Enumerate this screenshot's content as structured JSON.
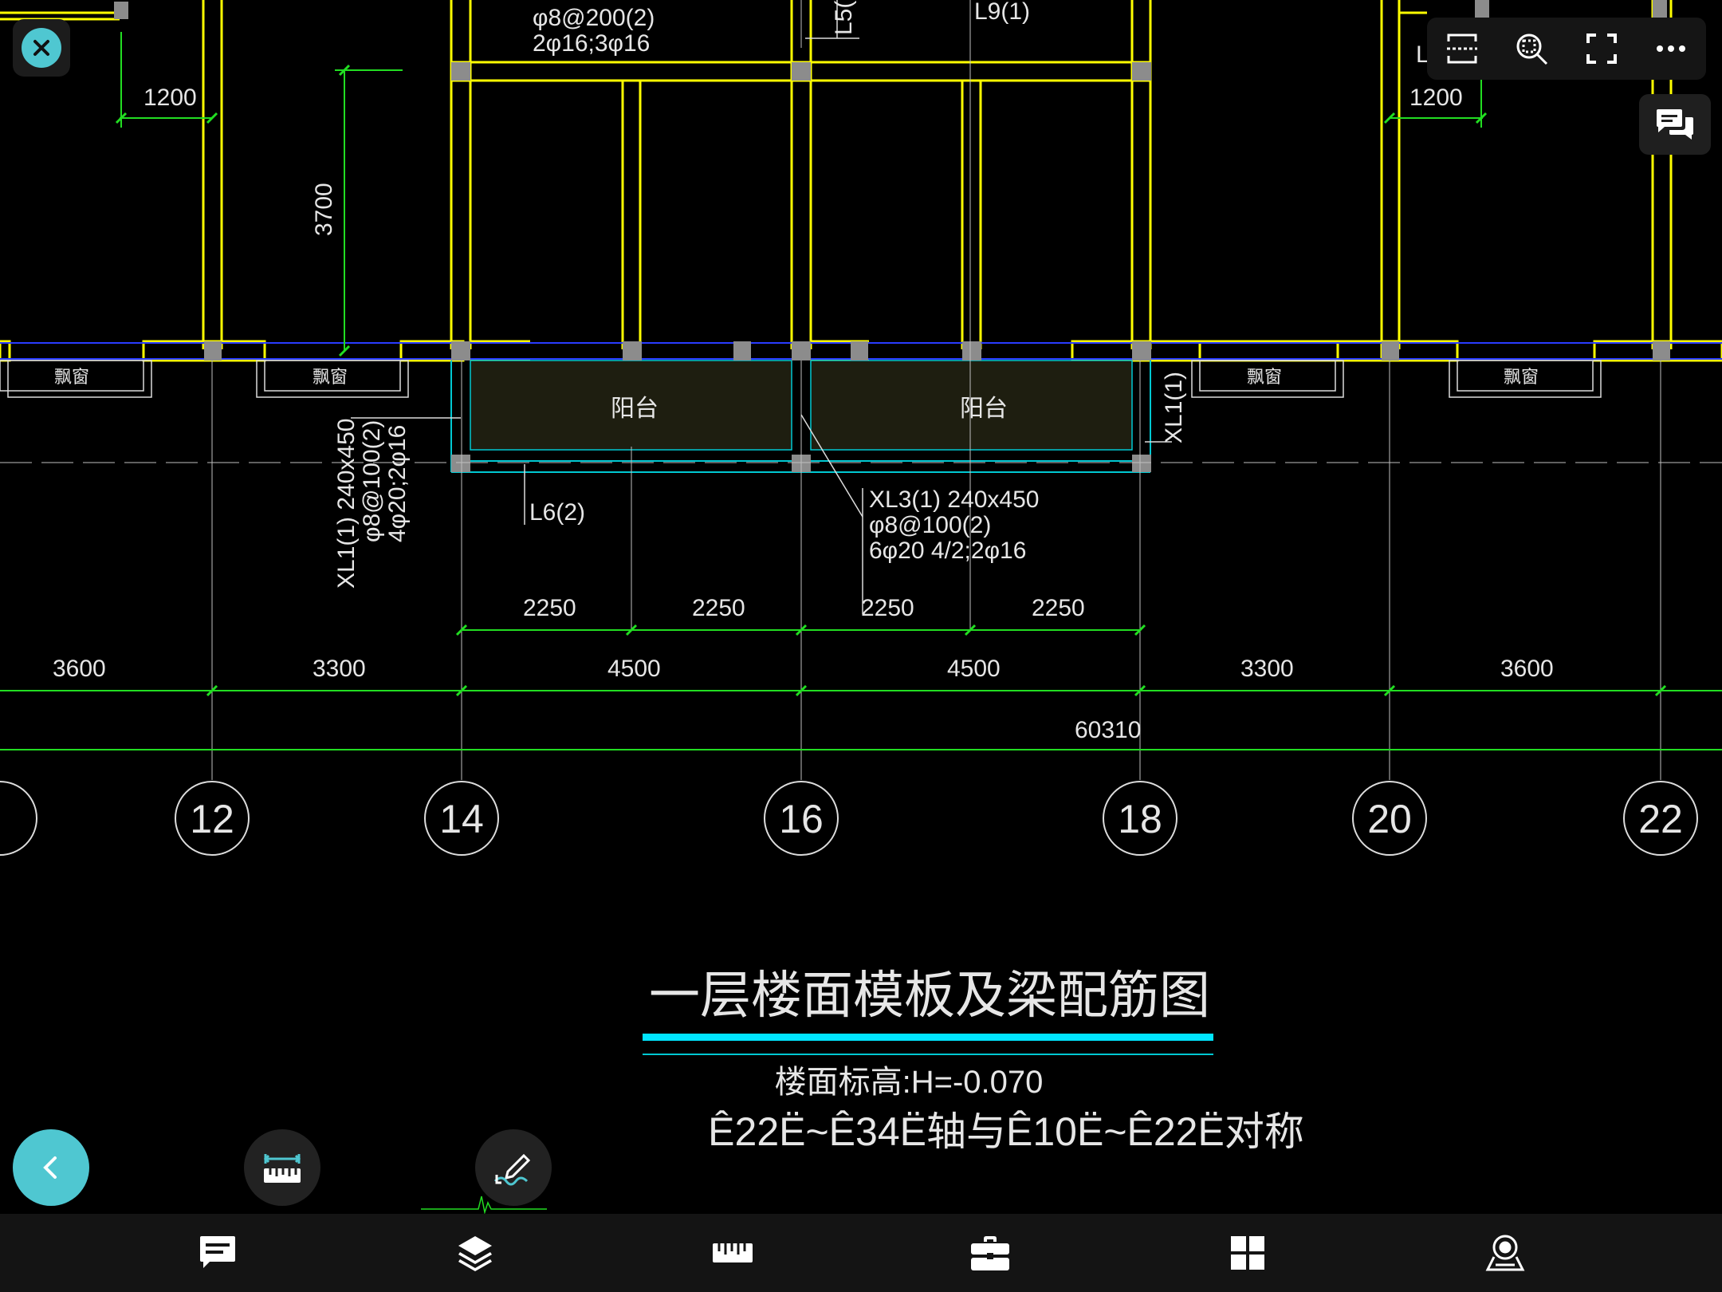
{
  "drawing": {
    "title": "一层楼面模板及梁配筋图",
    "subtitle": "楼面标高:H=-0.070",
    "note": "Ê22Ë~Ê34Ë轴与Ê10Ë~Ê22Ë对称",
    "colors": {
      "wall": "#ffff00",
      "dim": "#22dd22",
      "text": "#e6e6e6",
      "accent": "#00e5ff",
      "column": "#8c8c8c",
      "balcony_hatch": "#6a6a40"
    },
    "axis_bubbles": [
      "12",
      "14",
      "16",
      "18",
      "20",
      "22"
    ],
    "dims_total": "60310",
    "dims_bays": [
      "3600",
      "3300",
      "4500",
      "4500",
      "3300",
      "3600"
    ],
    "dims_sub": [
      "2250",
      "2250",
      "2250",
      "2250"
    ],
    "dim_vertical": "3700",
    "dim_window_left": "1200",
    "dim_window_right": "1200",
    "bay_window_labels": [
      "飘窗",
      "飘窗",
      "飘窗",
      "飘窗"
    ],
    "balcony_labels": [
      "阳台",
      "阳台"
    ],
    "beam_top_1": "φ8@200(2)",
    "beam_top_2": "2φ16;3φ16",
    "beam_l9": "L9(1)",
    "beam_l5": "L5(",
    "beam_l6": "L6(2)",
    "beam_xl1_right": "XL1(1)",
    "beam_xl1_left_1": "XL1(1) 240x450",
    "beam_xl1_left_2": "φ8@100(2)",
    "beam_xl1_left_3": "4φ20;2φ16",
    "beam_xl3_1": "XL3(1) 240x450",
    "beam_xl3_2": "φ8@100(2)",
    "beam_xl3_3": "6φ20 4/2;2φ16",
    "edge_label": "L"
  },
  "ui": {
    "close_icon": "close-icon",
    "top_toolbar": [
      "section-icon",
      "zoom-area-icon",
      "fullscreen-icon",
      "more-icon"
    ],
    "chat_icon": "comments-icon",
    "back_icon": "chevron-left-icon",
    "measure_icon": "ruler-measure-icon",
    "markup_icon": "markup-pen-icon",
    "bottom_nav": [
      "comment-icon",
      "layers-icon",
      "ruler-icon",
      "toolbox-icon",
      "grid-icon",
      "viewpoint-icon"
    ],
    "accent": "#4fc7d1"
  }
}
